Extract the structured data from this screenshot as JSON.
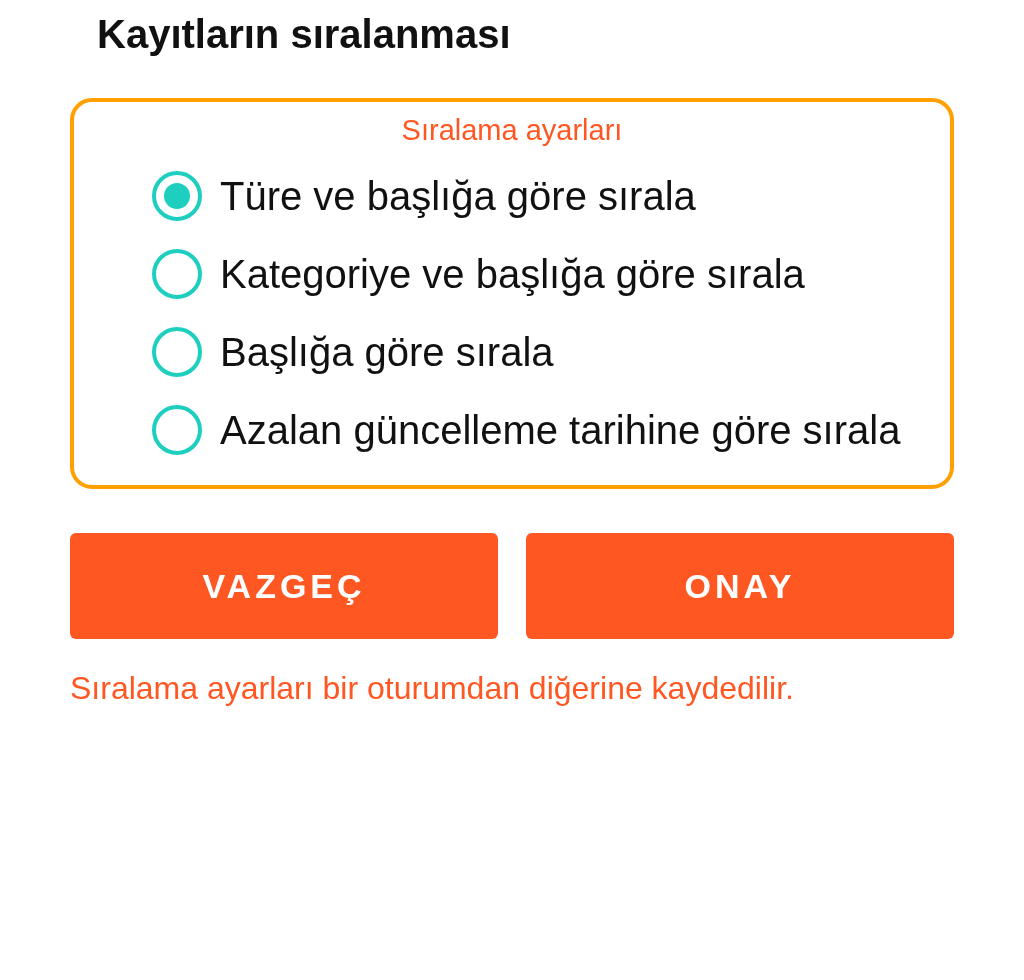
{
  "title": "Kayıtların sıralanması",
  "settings": {
    "legend": "Sıralama ayarları",
    "options": [
      {
        "label": "Türe ve başlığa göre sırala",
        "selected": true
      },
      {
        "label": "Kategoriye ve başlığa göre sırala",
        "selected": false
      },
      {
        "label": "Başlığa göre sırala",
        "selected": false
      },
      {
        "label": "Azalan güncelleme tarihine göre sırala",
        "selected": false
      }
    ]
  },
  "buttons": [
    {
      "label": "VAZGEÇ"
    },
    {
      "label": "ONAY"
    }
  ],
  "note": "Sıralama ayarları bir oturumdan diğerine kaydedilir."
}
